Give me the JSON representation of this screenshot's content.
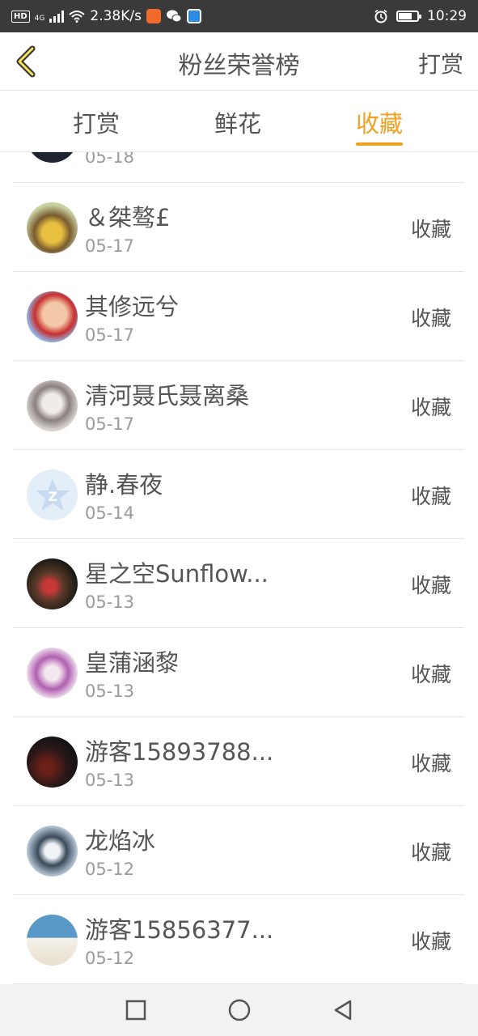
{
  "status_bar": {
    "network_badge": "HD",
    "network_type": "4G",
    "speed": "2.38K/s",
    "time": "10:29"
  },
  "header": {
    "title": "粉丝荣誉榜",
    "action": "打赏"
  },
  "tabs": [
    {
      "label": "打赏",
      "active": false
    },
    {
      "label": "鲜花",
      "active": false
    },
    {
      "label": "收藏",
      "active": true
    }
  ],
  "partial_row": {
    "date": "05-18"
  },
  "rows": [
    {
      "name": "＆桀骜£",
      "date": "05-17",
      "action": "收藏"
    },
    {
      "name": "其修远兮",
      "date": "05-17",
      "action": "收藏"
    },
    {
      "name": "清河聂氏聂离桑",
      "date": "05-17",
      "action": "收藏"
    },
    {
      "name": "静.春夜",
      "date": "05-14",
      "action": "收藏"
    },
    {
      "name": "星之空Sunflow...",
      "date": "05-13",
      "action": "收藏"
    },
    {
      "name": "皇蒲涵黎",
      "date": "05-13",
      "action": "收藏"
    },
    {
      "name": "游客15893788...",
      "date": "05-13",
      "action": "收藏"
    },
    {
      "name": "龙焰冰",
      "date": "05-12",
      "action": "收藏"
    },
    {
      "name": "游客15856377...",
      "date": "05-12",
      "action": "收藏"
    }
  ],
  "colors": {
    "accent": "#f0a020",
    "text": "#555555",
    "muted": "#9a9a9a",
    "status_bar": "#3a3a3a"
  }
}
